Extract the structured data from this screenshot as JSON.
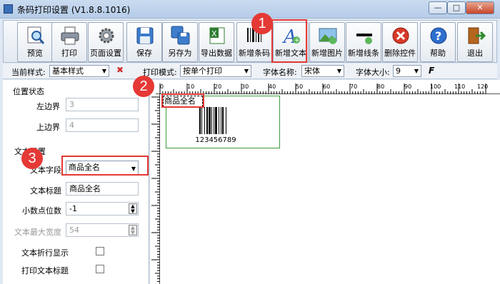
{
  "window": {
    "title": "条码打印设置 (V1.8.8.1016)",
    "min": "—",
    "max": "□",
    "close": "✕"
  },
  "toolbar": [
    {
      "label": "预览",
      "icon": "preview-icon"
    },
    {
      "label": "打印",
      "icon": "printer-icon"
    },
    {
      "label": "页面设置",
      "icon": "gear-icon"
    },
    {
      "label": "保存",
      "icon": "save-icon"
    },
    {
      "label": "另存为",
      "icon": "save-as-icon"
    },
    {
      "label": "导出数据",
      "icon": "excel-icon"
    },
    {
      "label": "新增条码",
      "icon": "barcode-icon"
    },
    {
      "label": "新增文本",
      "icon": "text-icon"
    },
    {
      "label": "新增图片",
      "icon": "picture-icon"
    },
    {
      "label": "新增线条",
      "icon": "line-icon"
    },
    {
      "label": "删除控件",
      "icon": "delete-icon"
    },
    {
      "label": "帮助",
      "icon": "help-icon"
    },
    {
      "label": "退出",
      "icon": "exit-icon"
    }
  ],
  "options": {
    "style_label": "当前样式:",
    "style_value": "基本样式",
    "mode_label": "打印模式:",
    "mode_value": "按单个打印",
    "font_label": "字体名称:",
    "font_value": "宋体",
    "size_label": "字体大小:",
    "size_value": "9",
    "bold": "F"
  },
  "position": {
    "title": "位置状态",
    "left_label": "左边界",
    "left_value": "3",
    "top_label": "上边界",
    "top_value": "4"
  },
  "text_settings": {
    "title": "文本设置",
    "field_label": "文本字段",
    "field_value": "商品全名",
    "title_label": "文本标题",
    "title_value": "商品全名",
    "decimals_label": "小数点位数",
    "decimals_value": "-1",
    "maxwidth_label": "文本最大宽度",
    "maxwidth_value": "54",
    "wrap_label": "文本折行显示",
    "printtitle_label": "打印文本标题"
  },
  "ruler": {
    "ticks": [
      "0",
      "10",
      "20",
      "30",
      "40",
      "50",
      "60",
      "70",
      "80",
      "90",
      "100",
      "110",
      "120"
    ]
  },
  "canvas": {
    "text_element": "商品全名",
    "barcode_number": "123456789"
  },
  "annotations": [
    "1",
    "2",
    "3"
  ],
  "colors": {
    "highlight": "#e53935",
    "label_border": "#3c9c3c"
  }
}
